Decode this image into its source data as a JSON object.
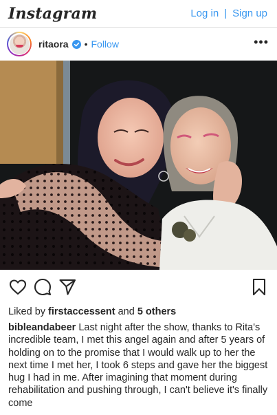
{
  "topbar": {
    "logo": "Instagram",
    "login_label": "Log in",
    "separator": "|",
    "signup_label": "Sign up"
  },
  "post": {
    "username": "ritaora",
    "verified_icon": "verified-badge-icon",
    "dot": "•",
    "follow_label": "Follow",
    "more_label": "•••",
    "photo_icon": "photo"
  },
  "actions": {
    "like_icon": "heart-icon",
    "comment_icon": "comment-icon",
    "share_icon": "send-icon",
    "save_icon": "bookmark-icon"
  },
  "likes": {
    "prefix": "Liked by ",
    "liker": "firstaccessent",
    "middle": " and ",
    "others": "5 others"
  },
  "caption": {
    "username": "bibleandabeer",
    "text": " Last night after the show, thanks to Rita's incredible team, I met this angel again and after 5 years of holding on to the promise that I would walk up to her  the next time I met her, I took 6 steps and gave her the biggest hug I had in me. After imagining that moment during rehabilitation and pushing through, I can't believe it's finally come"
  },
  "colors": {
    "link_blue": "#3897f0",
    "text": "#262626",
    "border": "#dbdbdb"
  }
}
